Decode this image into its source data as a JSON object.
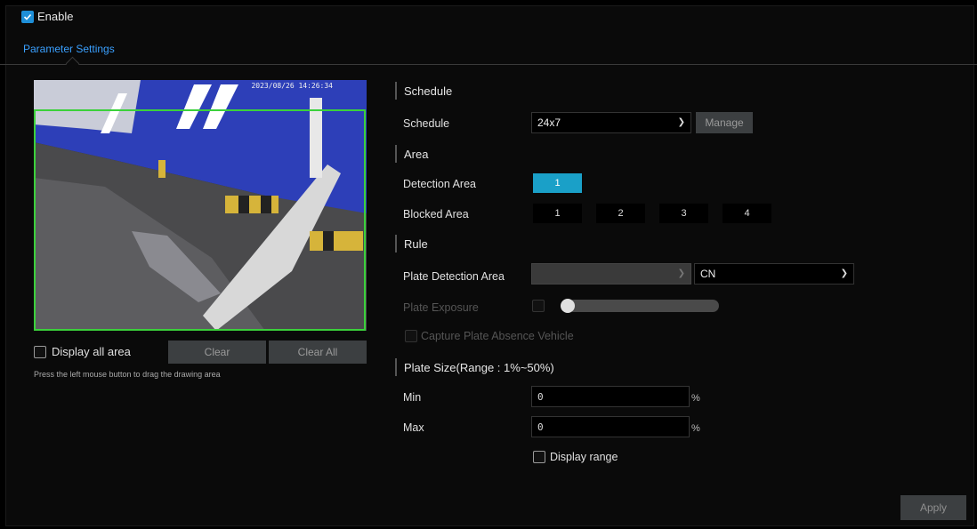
{
  "enable": {
    "label": "Enable",
    "checked": true
  },
  "tab": {
    "label": "Parameter Settings"
  },
  "video": {
    "timestamp": "2023/08/26 14:26:34"
  },
  "controls": {
    "display_all_area": "Display all area",
    "clear": "Clear",
    "clear_all": "Clear All",
    "hint": "Press the left mouse button to drag the drawing area"
  },
  "schedule": {
    "section": "Schedule",
    "label": "Schedule",
    "value": "24x7",
    "manage": "Manage"
  },
  "area": {
    "section": "Area",
    "detection_label": "Detection Area",
    "detection_buttons": [
      "1"
    ],
    "blocked_label": "Blocked Area",
    "blocked_buttons": [
      "1",
      "2",
      "3",
      "4"
    ]
  },
  "rule": {
    "section": "Rule",
    "plate_detection_label": "Plate Detection Area",
    "plate_detection_value": "",
    "region_value": "CN",
    "plate_exposure_label": "Plate Exposure",
    "capture_absence_label": "Capture Plate Absence Vehicle"
  },
  "plate_size": {
    "section": "Plate Size(Range : 1%~50%)",
    "min_label": "Min",
    "min_value": "0",
    "max_label": "Max",
    "max_value": "0",
    "unit": "%",
    "display_range": "Display range"
  },
  "apply": "Apply",
  "colors": {
    "accent": "#1aa0c8",
    "tab": "#3aa0ff",
    "detection_box": "#3bd13b"
  }
}
